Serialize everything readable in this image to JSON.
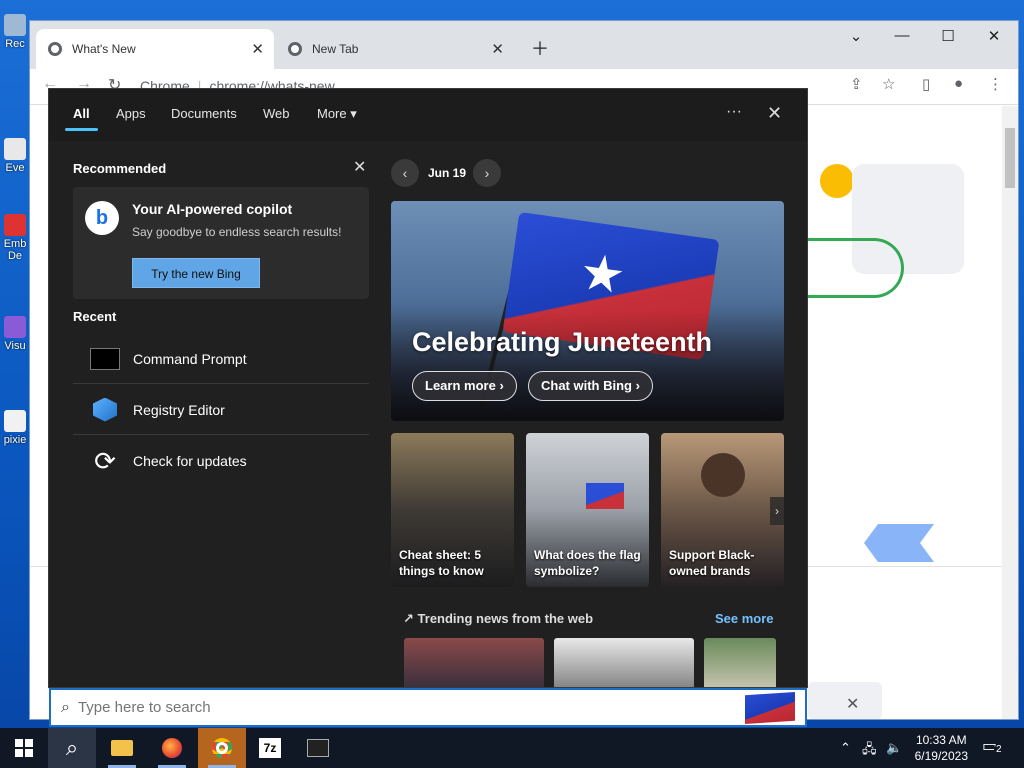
{
  "desktop": {
    "icons": [
      {
        "label": "Rec"
      },
      {
        "label": "Eve"
      },
      {
        "label": "Emb De"
      },
      {
        "label": "Visu"
      },
      {
        "label": "pixie"
      }
    ]
  },
  "browser": {
    "tabs": [
      {
        "title": "What's New"
      },
      {
        "title": "New Tab"
      }
    ],
    "new_tab_icon": "plus-icon",
    "omnibox": {
      "site": "Chrome",
      "url": "chrome://whats-new"
    }
  },
  "flyout": {
    "tabs": [
      "All",
      "Apps",
      "Documents",
      "Web",
      "More"
    ],
    "active_tab": "All",
    "recommended": {
      "title": "Recommended",
      "card_title": "Your AI-powered copilot",
      "card_subtitle": "Say goodbye to endless search results!",
      "button": "Try the new Bing"
    },
    "recent": {
      "title": "Recent",
      "items": [
        {
          "label": "Command Prompt",
          "icon": "command-prompt-icon"
        },
        {
          "label": "Registry Editor",
          "icon": "registry-editor-icon"
        },
        {
          "label": "Check for updates",
          "icon": "update-icon"
        }
      ]
    },
    "date_nav": {
      "date": "Jun 19"
    },
    "hero": {
      "title": "Celebrating Juneteenth",
      "learn_more": "Learn more",
      "chat": "Chat with Bing"
    },
    "cards": [
      {
        "title": "Cheat sheet: 5 things to know"
      },
      {
        "title": "What does the flag symbolize?"
      },
      {
        "title": "Support Black-owned brands"
      }
    ],
    "trending": {
      "title": "Trending news from the web",
      "see_more": "See more"
    }
  },
  "search": {
    "placeholder": "Type here to search"
  },
  "taskbar": {
    "apps": [
      "start-icon",
      "search-icon",
      "file-explorer-icon",
      "firefox-icon",
      "chrome-icon",
      "7zip-icon",
      "terminal-icon"
    ],
    "sevenzip_label": "7z",
    "time": "10:33 AM",
    "date": "6/19/2023",
    "notifications": "2"
  },
  "colors": {
    "accent": "#4cc2ff",
    "taskbar": "#101826",
    "flyout_bg": "#202020"
  }
}
